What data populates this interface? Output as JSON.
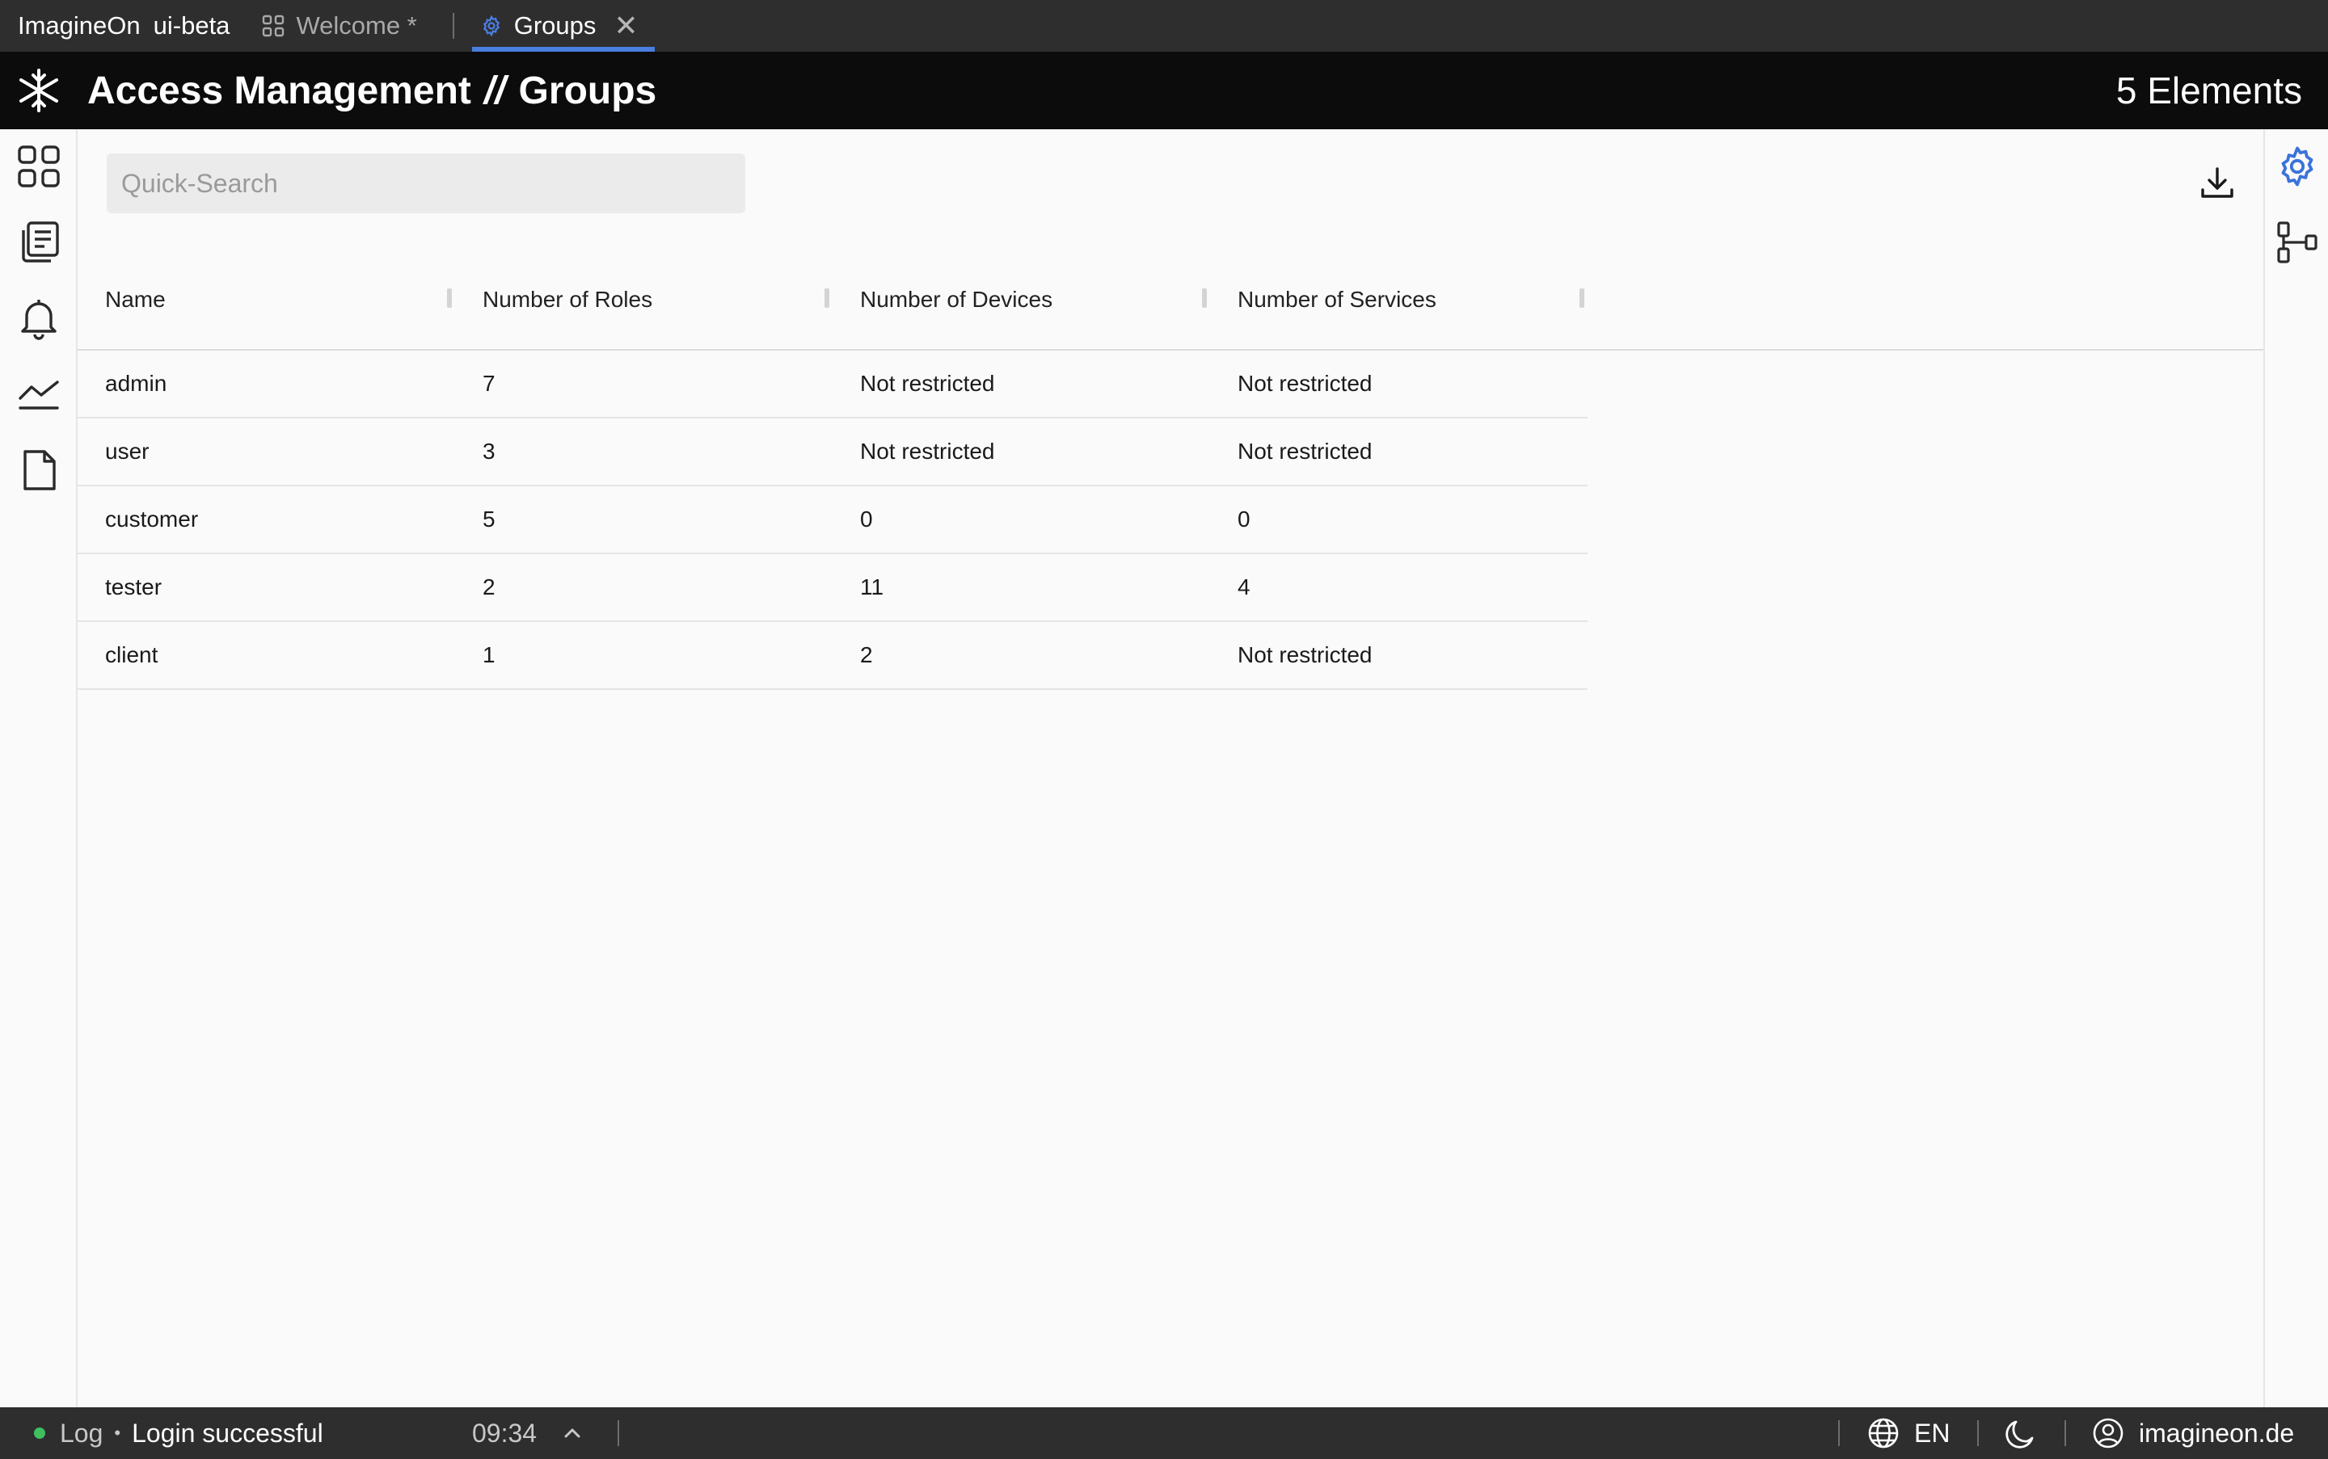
{
  "app": {
    "brand": "ImagineOn",
    "environment": "ui-beta"
  },
  "tabs": [
    {
      "label": "Welcome *",
      "icon": "grid-icon",
      "active": false
    },
    {
      "label": "Groups",
      "icon": "gear-icon",
      "active": true
    }
  ],
  "header": {
    "title_section": "Access Management",
    "title_separator": "//",
    "title_page": "Groups",
    "element_count": "5 Elements"
  },
  "left_nav": [
    {
      "name": "dashboard-icon"
    },
    {
      "name": "documents-icon"
    },
    {
      "name": "bell-icon"
    },
    {
      "name": "chart-line-icon"
    },
    {
      "name": "file-icon"
    }
  ],
  "right_nav": [
    {
      "name": "settings-gear-icon",
      "color": "#3b73d9"
    },
    {
      "name": "hierarchy-icon"
    }
  ],
  "search": {
    "placeholder": "Quick-Search",
    "value": ""
  },
  "table": {
    "columns": [
      "Name",
      "Number of Roles",
      "Number of Devices",
      "Number of Services"
    ],
    "rows": [
      [
        "admin",
        "7",
        "Not restricted",
        "Not restricted"
      ],
      [
        "user",
        "3",
        "Not restricted",
        "Not restricted"
      ],
      [
        "customer",
        "5",
        "0",
        "0"
      ],
      [
        "tester",
        "2",
        "11",
        "4"
      ],
      [
        "client",
        "1",
        "2",
        "Not restricted"
      ]
    ]
  },
  "status": {
    "log_label": "Log",
    "bullet": "•",
    "message": "Login successful",
    "time": "09:34",
    "language": "EN",
    "account": "imagineon.de",
    "indicator_color": "#3fbf5f"
  },
  "colors": {
    "accent": "#4a7ee0",
    "topbar": "#2e2e2e",
    "header": "#0c0c0c"
  }
}
